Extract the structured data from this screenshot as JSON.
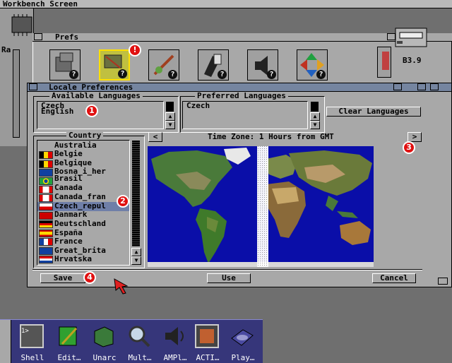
{
  "screen": {
    "title": "Workbench Screen"
  },
  "desktop": {
    "ram_label": "Ra",
    "disk_label": "B3.9"
  },
  "prefs_window": {
    "title": "Prefs"
  },
  "locale_window": {
    "title": "Locale Preferences",
    "available_languages_label": "Available Languages",
    "available_languages": [
      "Czech",
      "English"
    ],
    "preferred_languages_label": "Preferred Languages",
    "preferred_languages": [
      "Czech"
    ],
    "clear_languages_button": "Clear Languages",
    "country_label": "Country",
    "countries": [
      {
        "name": "Australia",
        "flag": ""
      },
      {
        "name": "Belgie",
        "flag": "be"
      },
      {
        "name": "Belgique",
        "flag": "be"
      },
      {
        "name": "Bosna_i_her",
        "flag": "ba"
      },
      {
        "name": "Brasil",
        "flag": "br"
      },
      {
        "name": "Canada",
        "flag": "ca"
      },
      {
        "name": "Canada_fran",
        "flag": "ca"
      },
      {
        "name": "Czech_repul",
        "flag": "cz"
      },
      {
        "name": "Danmark",
        "flag": "dk"
      },
      {
        "name": "Deutschland",
        "flag": "de"
      },
      {
        "name": "España",
        "flag": "es"
      },
      {
        "name": "France",
        "flag": "fr"
      },
      {
        "name": "Great_brita",
        "flag": "gb"
      },
      {
        "name": "Hrvatska",
        "flag": "hr"
      }
    ],
    "selected_country": "Czech_repul",
    "timezone_text": "Time Zone: 1 Hours from GMT",
    "prev_timezone": "<",
    "next_timezone": ">",
    "save_button": "Save",
    "use_button": "Use",
    "cancel_button": "Cancel"
  },
  "annotations": [
    "!",
    "1",
    "2",
    "3",
    "4"
  ],
  "dock": [
    {
      "label": "Shell"
    },
    {
      "label": "Edit…"
    },
    {
      "label": "Unarc"
    },
    {
      "label": "Mult…"
    },
    {
      "label": "AMPl…"
    },
    {
      "label": "ACTI…"
    },
    {
      "label": "Play…"
    }
  ],
  "colors": {
    "window_bg": "#a8a8a8",
    "selection": "#6f7fa8",
    "ocean": "#0a0ea8",
    "badge": "#e01010"
  }
}
